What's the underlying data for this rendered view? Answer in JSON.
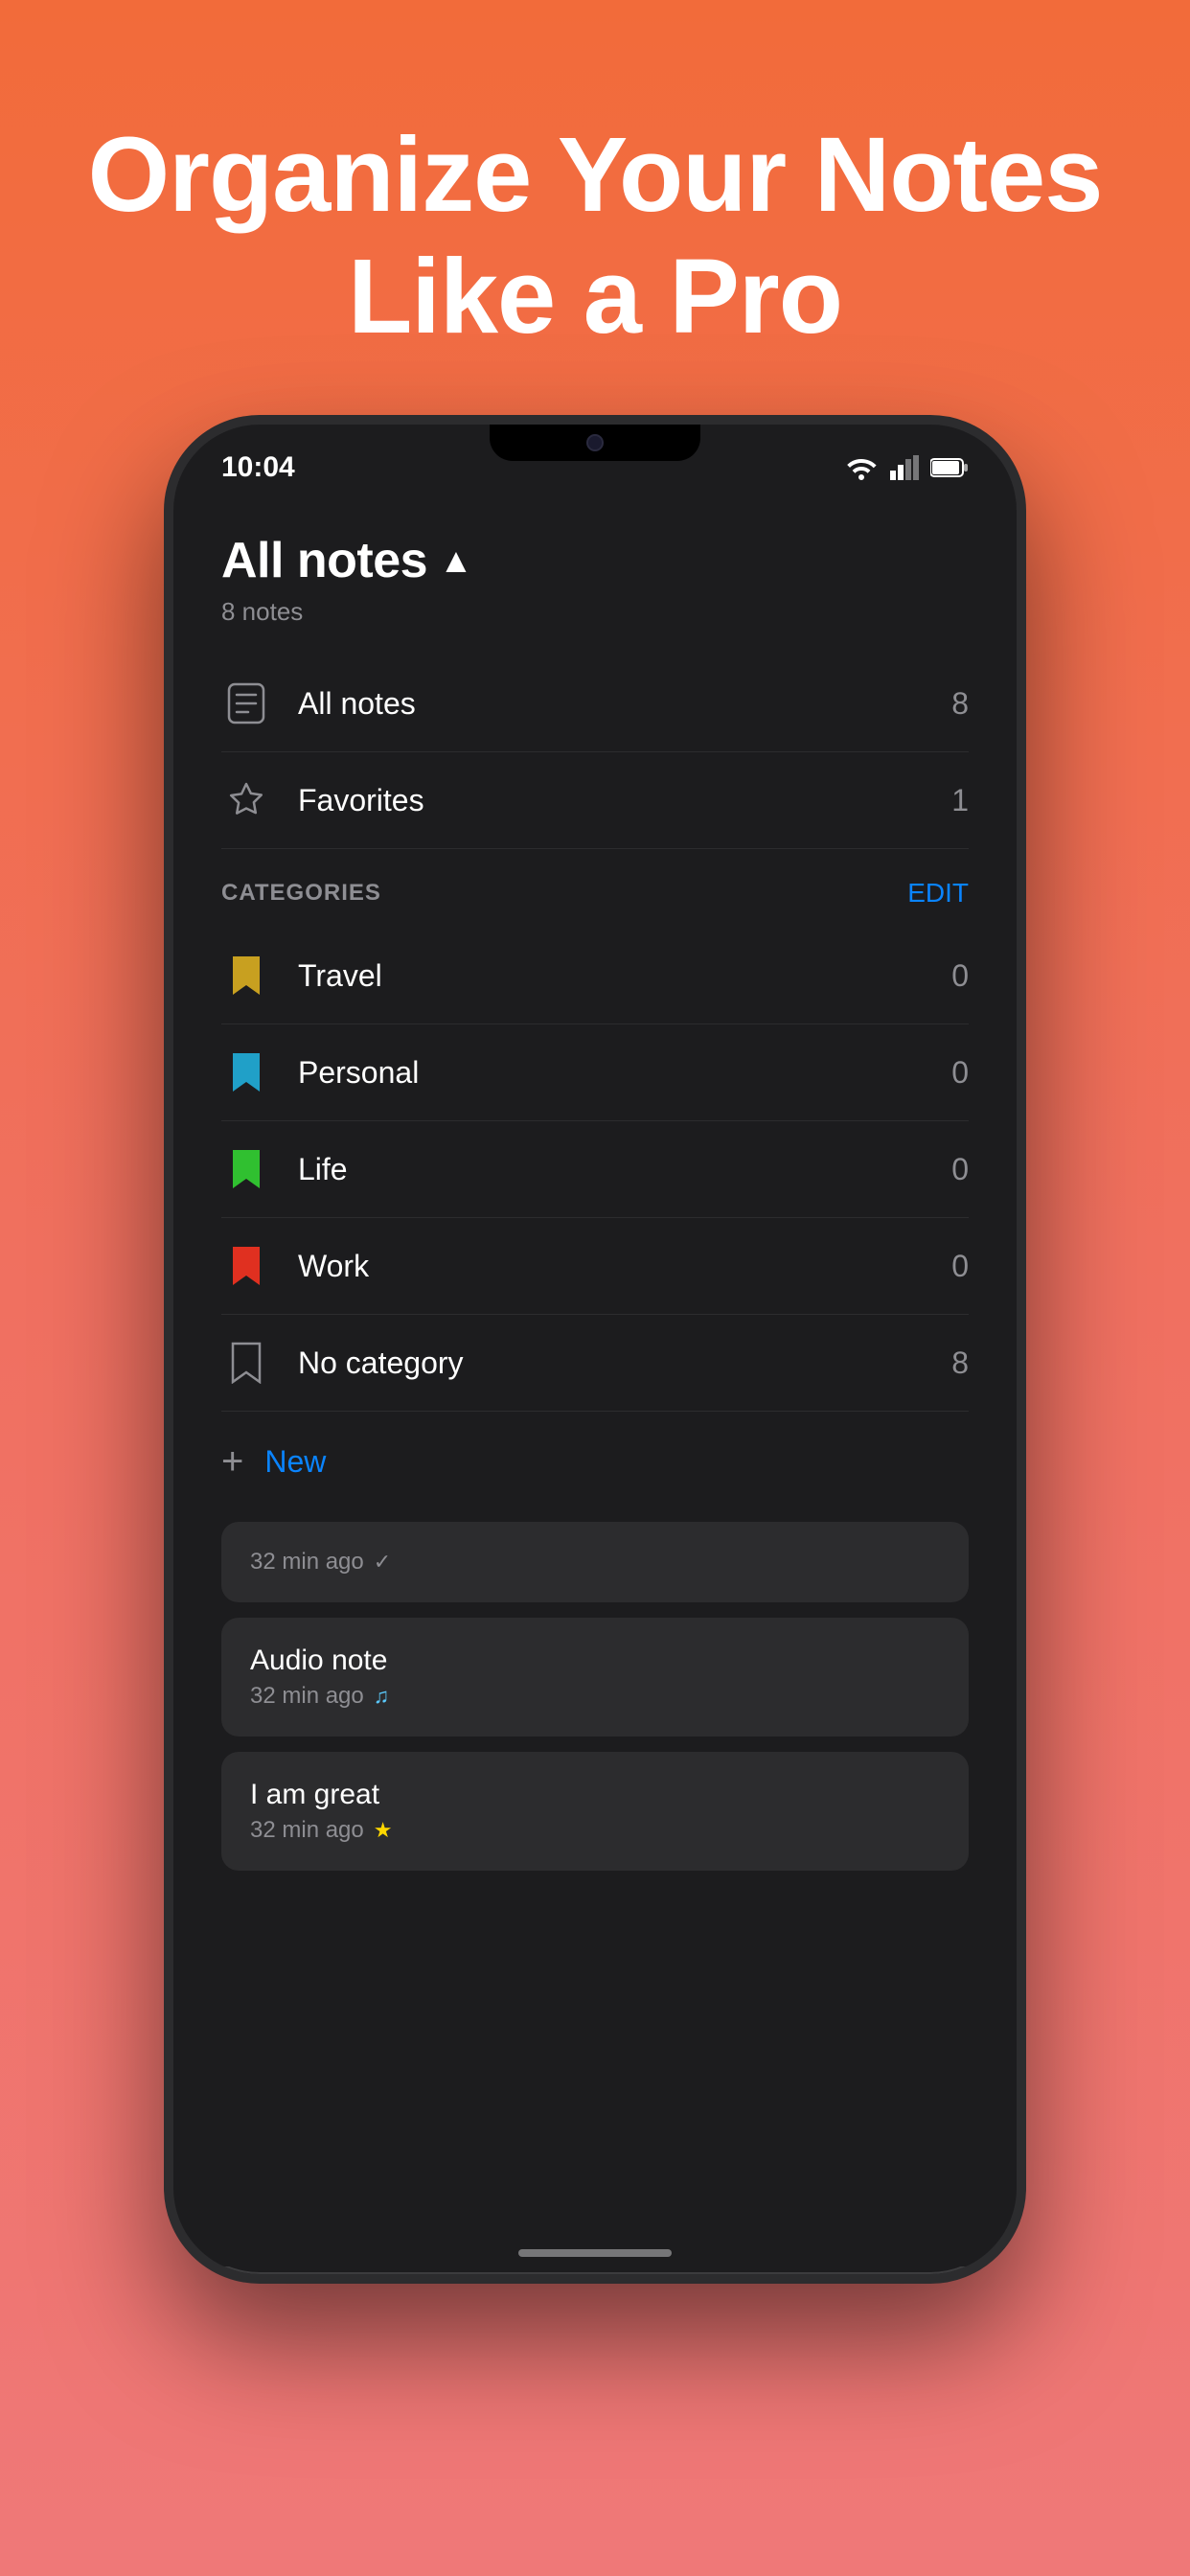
{
  "hero": {
    "title": "Organize Your Notes Like a Pro"
  },
  "phone": {
    "status": {
      "time": "10:04"
    },
    "screen": {
      "title": "All notes",
      "subtitle": "8 notes",
      "all_notes_label": "All notes",
      "all_notes_count": "8",
      "favorites_label": "Favorites",
      "favorites_count": "1",
      "categories_label": "CATEGORIES",
      "edit_label": "EDIT",
      "categories": [
        {
          "name": "Travel",
          "count": "0",
          "color": "#C8A020"
        },
        {
          "name": "Personal",
          "count": "0",
          "color": "#20A0C8"
        },
        {
          "name": "Life",
          "count": "0",
          "color": "#30C030"
        },
        {
          "name": "Work",
          "count": "0",
          "color": "#E03020"
        },
        {
          "name": "No category",
          "count": "8",
          "color": "#808080"
        }
      ],
      "new_label": "New",
      "notes": [
        {
          "title": "",
          "meta": "32 min ago",
          "icon": "✓",
          "icon_color": "#8E8E93"
        },
        {
          "title": "Audio note",
          "meta": "32 min ago",
          "icon": "🎵",
          "icon_color": "#5AC8FA"
        },
        {
          "title": "I am great",
          "meta": "32 min ago",
          "icon": "⭐",
          "icon_color": "#FFD700"
        }
      ]
    }
  }
}
